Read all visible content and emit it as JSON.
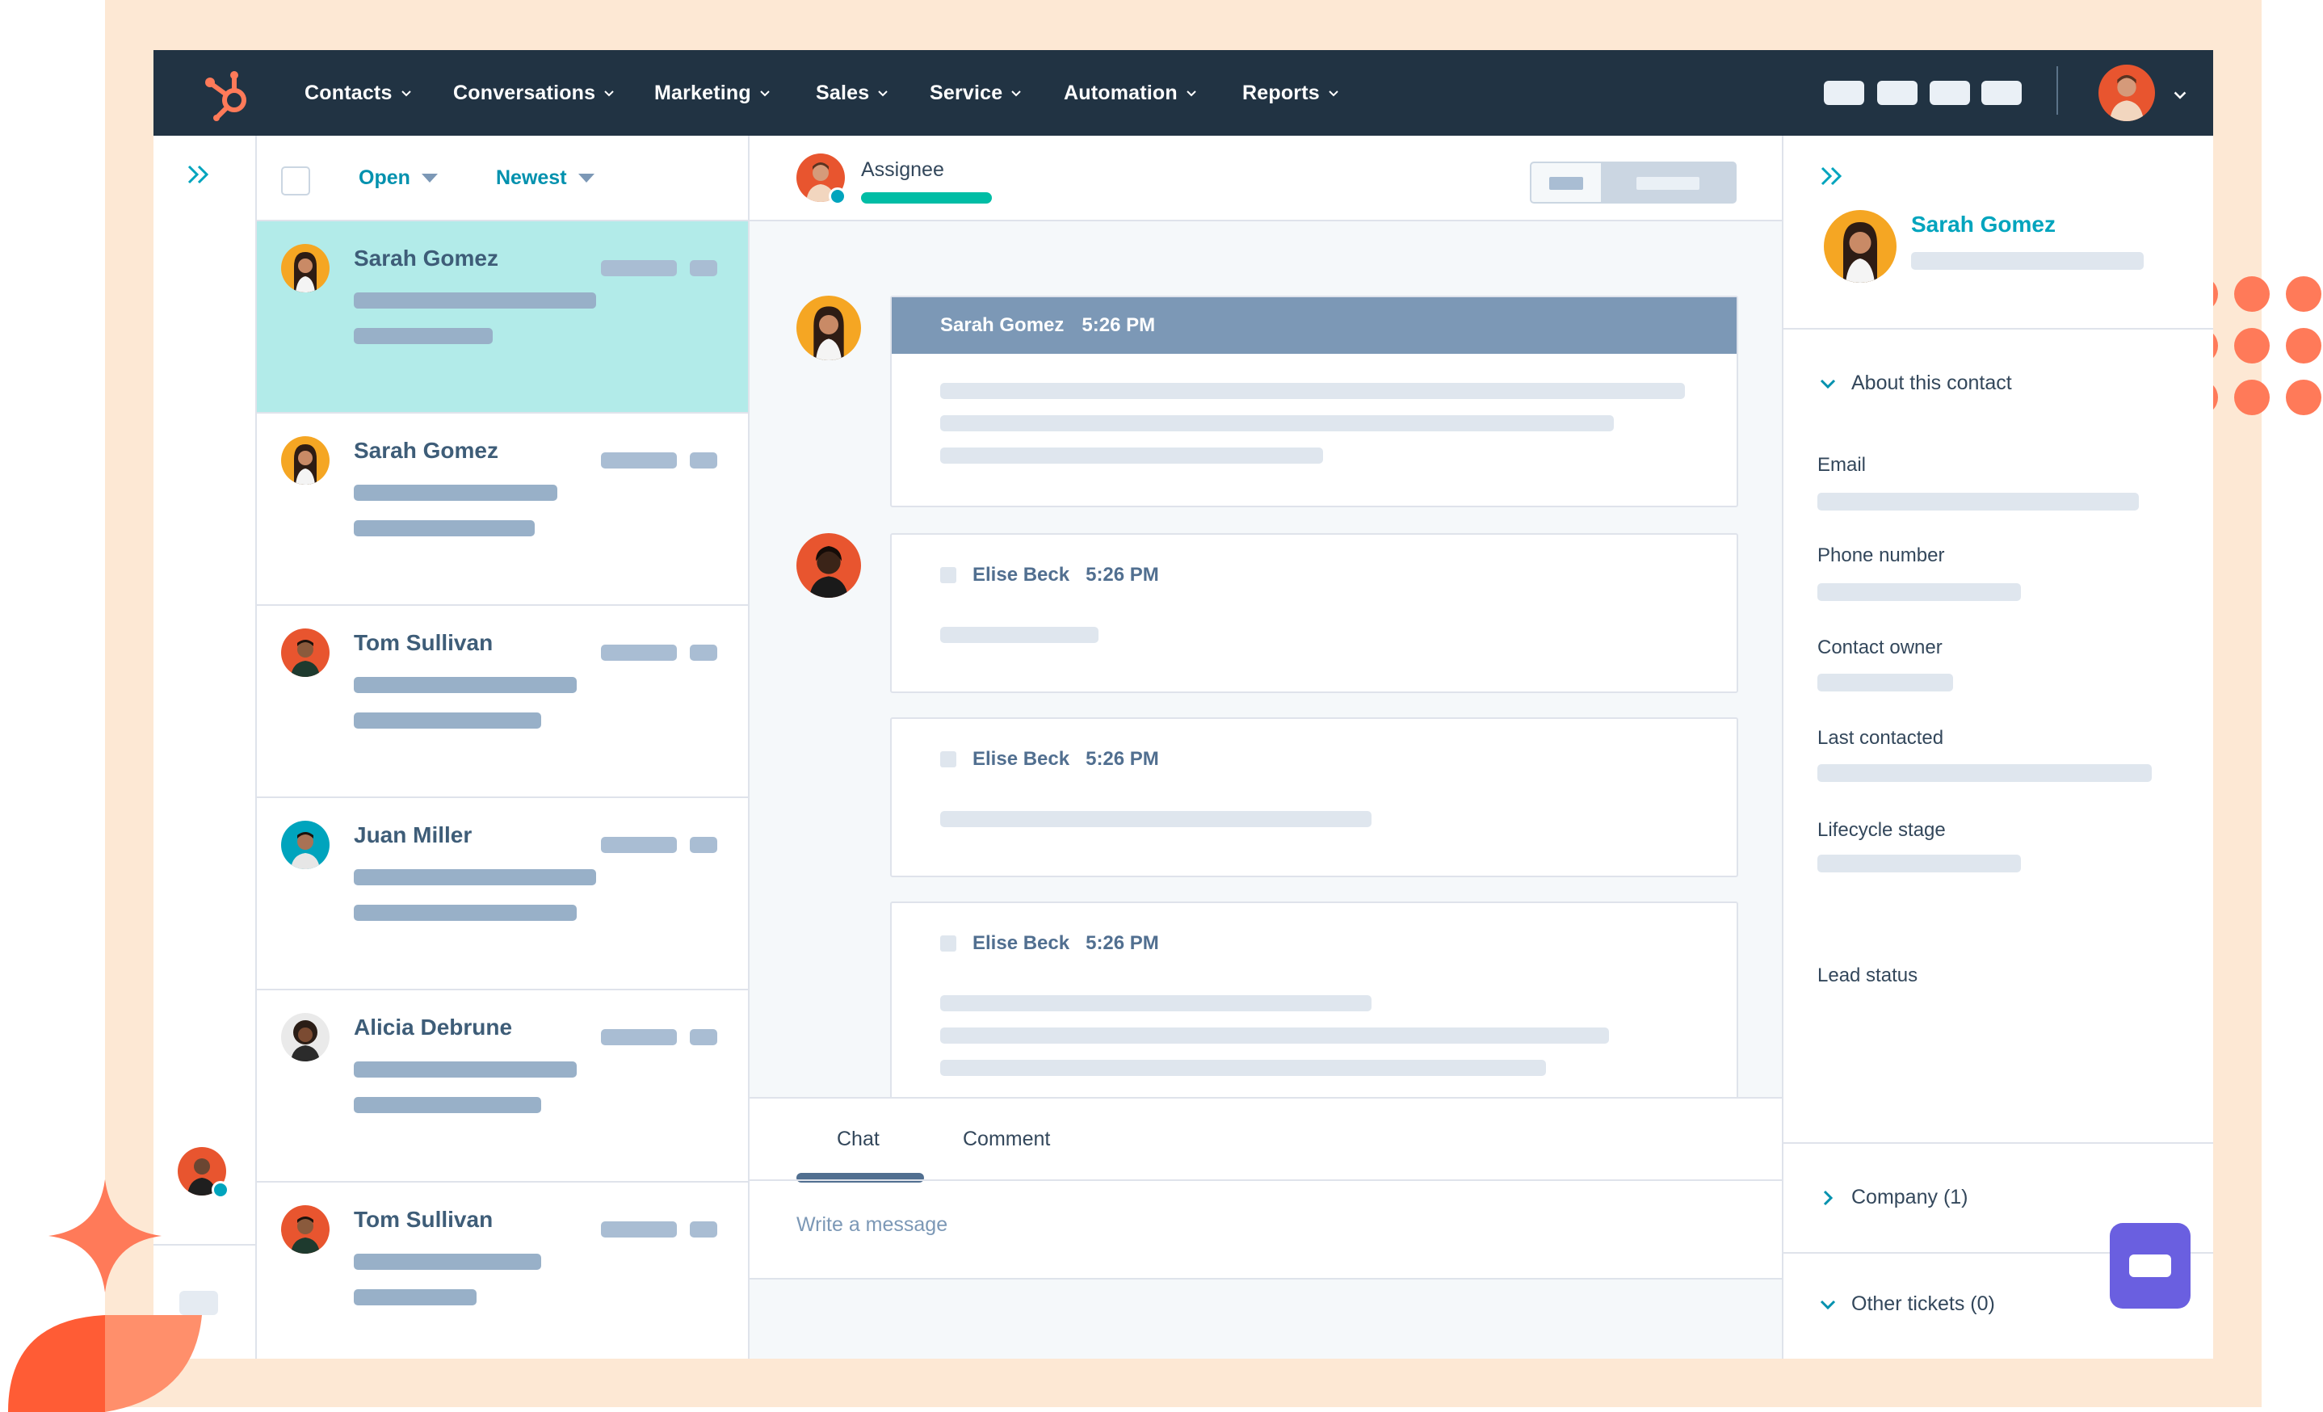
{
  "nav": {
    "items": [
      "Contacts",
      "Conversations",
      "Marketing",
      "Sales",
      "Service",
      "Automation",
      "Reports"
    ]
  },
  "inbox": {
    "filter_status": "Open",
    "filter_sort": "Newest",
    "rows": [
      {
        "name": "Sarah Gomez",
        "active": true
      },
      {
        "name": "Sarah Gomez",
        "active": false
      },
      {
        "name": "Tom Sullivan",
        "active": false
      },
      {
        "name": "Juan Miller",
        "active": false
      },
      {
        "name": "Alicia Debrune",
        "active": false
      },
      {
        "name": "Tom Sullivan",
        "active": false
      }
    ]
  },
  "conversation": {
    "assignee_label": "Assignee",
    "messages": [
      {
        "sender": "Sarah Gomez",
        "time": "5:26 PM"
      },
      {
        "sender": "Elise Beck",
        "time": "5:26 PM"
      },
      {
        "sender": "Elise Beck",
        "time": "5:26 PM"
      },
      {
        "sender": "Elise Beck",
        "time": "5:26 PM"
      }
    ],
    "composer": {
      "tabs": [
        "Chat",
        "Comment"
      ],
      "active_tab": "Chat",
      "placeholder": "Write a message"
    }
  },
  "contact": {
    "name": "Sarah Gomez",
    "about_section": "About this contact",
    "properties": [
      "Email",
      "Phone number",
      "Contact owner",
      "Last contacted",
      "Lifecycle stage",
      "Lead status"
    ],
    "company_section": "Company (1)",
    "tickets_section": "Other tickets (0)"
  },
  "colors": {
    "nav_bg": "#213343",
    "active_row": "#b2ebe9",
    "accent_teal": "#00a4bd",
    "brand_orange": "#ff7a59",
    "chat_button": "#6a5fe0"
  },
  "icons": [
    "hubspot-logo-icon",
    "chevron-down-icon",
    "double-chevron-right-icon",
    "chevron-right-icon",
    "chat-icon"
  ]
}
